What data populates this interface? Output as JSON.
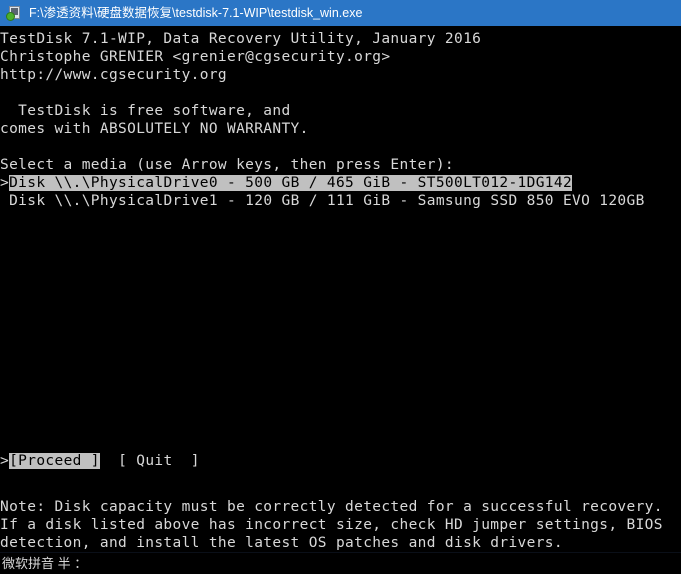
{
  "window": {
    "title": "F:\\渗透资料\\硬盘数据恢复\\testdisk-7.1-WIP\\testdisk_win.exe",
    "icon": "application-exe-icon",
    "titlebar_color": "#2b76c6",
    "background_color": "#000000",
    "foreground_color": "#d8d8d8",
    "highlight_background": "#c0c0c0",
    "highlight_foreground": "#000000"
  },
  "console": {
    "header": {
      "line1": "TestDisk 7.1-WIP, Data Recovery Utility, January 2016",
      "line2": "Christophe GRENIER <grenier@cgsecurity.org>",
      "line3": "http://www.cgsecurity.org"
    },
    "license": {
      "line1": "  TestDisk is free software, and",
      "line2": "comes with ABSOLUTELY NO WARRANTY."
    },
    "prompt": "Select a media (use Arrow keys, then press Enter):",
    "media_list": [
      {
        "cursor": ">",
        "text": "Disk \\\\.\\PhysicalDrive0 - 500 GB / 465 GiB - ST500LT012-1DG142",
        "selected": true,
        "device": "\\\\.\\PhysicalDrive0",
        "size_gb": "500 GB",
        "size_gib": "465 GiB",
        "model": "ST500LT012-1DG142"
      },
      {
        "cursor": " ",
        "text": "Disk \\\\.\\PhysicalDrive1 - 120 GB / 111 GiB - Samsung SSD 850 EVO 120GB",
        "selected": false,
        "device": "\\\\.\\PhysicalDrive1",
        "size_gb": "120 GB",
        "size_gib": "111 GiB",
        "model": "Samsung SSD 850 EVO 120GB"
      }
    ],
    "actions": {
      "cursor": ">",
      "proceed": "[Proceed ]",
      "quit": "[ Quit  ]"
    },
    "note": {
      "line1": "Note: Disk capacity must be correctly detected for a successful recovery.",
      "line2": "If a disk listed above has incorrect size, check HD jumper settings, BIOS",
      "line3": "detection, and install the latest OS patches and disk drivers."
    }
  },
  "ime": {
    "status": "微软拼音 半 ："
  }
}
